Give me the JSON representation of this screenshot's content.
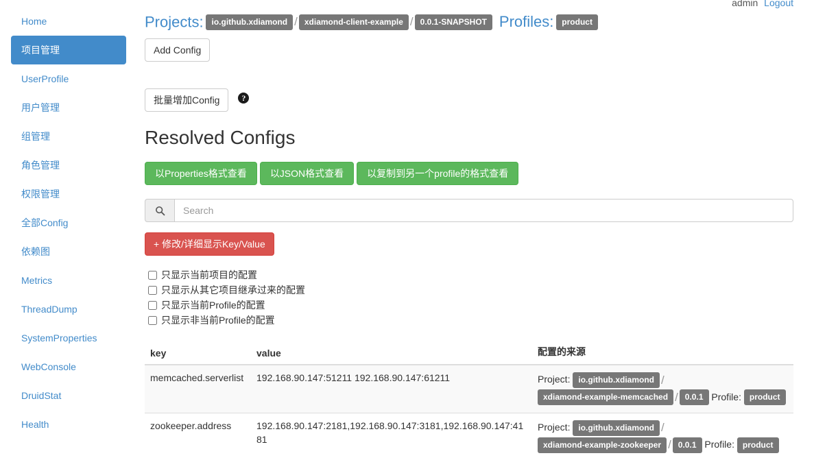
{
  "userbar": {
    "username": "admin",
    "logout_label": "Logout"
  },
  "sidebar": {
    "items": [
      {
        "label": "Home",
        "active": false
      },
      {
        "label": "项目管理",
        "active": true
      },
      {
        "label": "UserProfile",
        "active": false
      },
      {
        "label": "用户管理",
        "active": false
      },
      {
        "label": "组管理",
        "active": false
      },
      {
        "label": "角色管理",
        "active": false
      },
      {
        "label": "权限管理",
        "active": false
      },
      {
        "label": "全部Config",
        "active": false
      },
      {
        "label": "依赖图",
        "active": false
      },
      {
        "label": "Metrics",
        "active": false
      },
      {
        "label": "ThreadDump",
        "active": false
      },
      {
        "label": "SystemProperties",
        "active": false
      },
      {
        "label": "WebConsole",
        "active": false
      },
      {
        "label": "DruidStat",
        "active": false
      },
      {
        "label": "Health",
        "active": false
      }
    ]
  },
  "breadcrumb": {
    "projects_label": "Projects:",
    "project_tags": [
      "io.github.xdiamond",
      "xdiamond-client-example",
      "0.0.1-SNAPSHOT"
    ],
    "separator": "/",
    "profiles_label": "Profiles:",
    "profile_tags": [
      "product"
    ]
  },
  "actions": {
    "add_config_label": "Add Config",
    "batch_add_label": "批量增加Config",
    "help_icon_glyph": "?"
  },
  "section": {
    "title": "Resolved Configs"
  },
  "view_buttons": [
    {
      "label": "以Properties格式查看"
    },
    {
      "label": "以JSON格式查看"
    },
    {
      "label": "以复制到另一个profile的格式查看"
    }
  ],
  "search": {
    "placeholder": "Search",
    "value": "",
    "icon": "search-icon"
  },
  "modify_button": {
    "label": "+ 修改/详细显示Key/Value"
  },
  "filters": [
    {
      "label": "只显示当前项目的配置",
      "checked": false
    },
    {
      "label": "只显示从其它项目继承过来的配置",
      "checked": false
    },
    {
      "label": "只显示当前Profile的配置",
      "checked": false
    },
    {
      "label": "只显示非当前Profile的配置",
      "checked": false
    }
  ],
  "table": {
    "headers": {
      "key": "key",
      "value": "value",
      "source": "配置的来源"
    },
    "rows": [
      {
        "key": "memcached.serverlist",
        "value": "192.168.90.147:51211 192.168.90.147:61211",
        "source": {
          "project_label": "Project:",
          "project_tags": [
            "io.github.xdiamond",
            "xdiamond-example-memcached",
            "0.0.1"
          ],
          "profile_label": "Profile:",
          "profile_tags": [
            "product"
          ]
        }
      },
      {
        "key": "zookeeper.address",
        "value": "192.168.90.147:2181,192.168.90.147:3181,192.168.90.147:4181",
        "source": {
          "project_label": "Project:",
          "project_tags": [
            "io.github.xdiamond",
            "xdiamond-example-zookeeper",
            "0.0.1"
          ],
          "profile_label": "Profile:",
          "profile_tags": [
            "product"
          ]
        }
      }
    ]
  },
  "colors": {
    "primary": "#428bca",
    "success": "#5cb85c",
    "danger": "#d9534f",
    "tag": "#777777"
  }
}
